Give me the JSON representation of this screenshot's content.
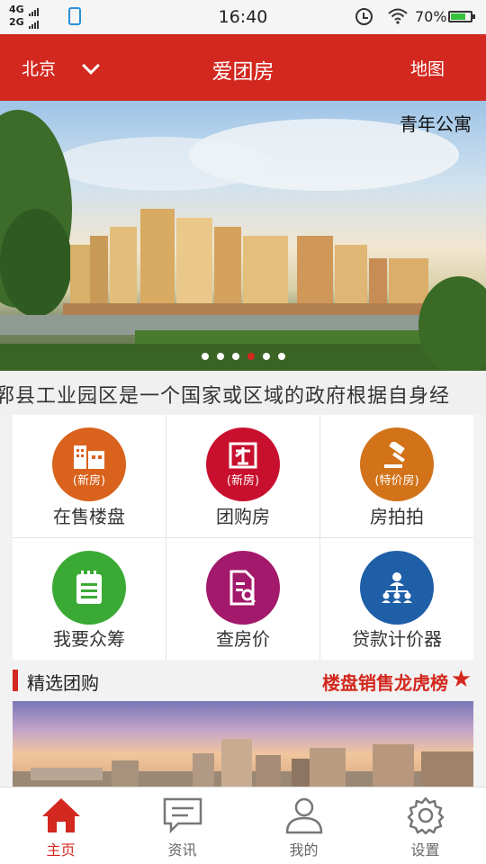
{
  "statusbar": {
    "net1": "4G",
    "net2": "2G",
    "time": "16:40",
    "battery": "70%"
  },
  "header": {
    "city": "北京",
    "title": "爱团房",
    "map": "地图"
  },
  "banner": {
    "label": "青年公寓",
    "slide_count": 6,
    "active_slide": 4
  },
  "marquee": {
    "text": "郛县工业园区是一个国家或区域的政府根据自身经"
  },
  "grid": [
    {
      "label": "在售楼盘",
      "badge": "(新房)",
      "icon": "building-icon",
      "color": "#d9621c"
    },
    {
      "label": "团购房",
      "badge": "(新房)",
      "icon": "group-icon",
      "color": "#c8102e"
    },
    {
      "label": "房拍拍",
      "badge": "(特价房)",
      "icon": "gavel-icon",
      "color": "#d2731a"
    },
    {
      "label": "我要众筹",
      "badge": "",
      "icon": "notepad-icon",
      "color": "#3aaa35"
    },
    {
      "label": "查房价",
      "badge": "",
      "icon": "document-search-icon",
      "color": "#a3196b"
    },
    {
      "label": "贷款计价器",
      "badge": "",
      "icon": "org-chart-icon",
      "color": "#1f5fa8"
    }
  ],
  "section": {
    "title": "精选团购",
    "link": "楼盘销售龙虎榜"
  },
  "tabs": [
    {
      "label": "主页",
      "icon": "home-icon",
      "active": true
    },
    {
      "label": "资讯",
      "icon": "message-icon",
      "active": false
    },
    {
      "label": "我的",
      "icon": "user-icon",
      "active": false
    },
    {
      "label": "设置",
      "icon": "gear-icon",
      "active": false
    }
  ]
}
